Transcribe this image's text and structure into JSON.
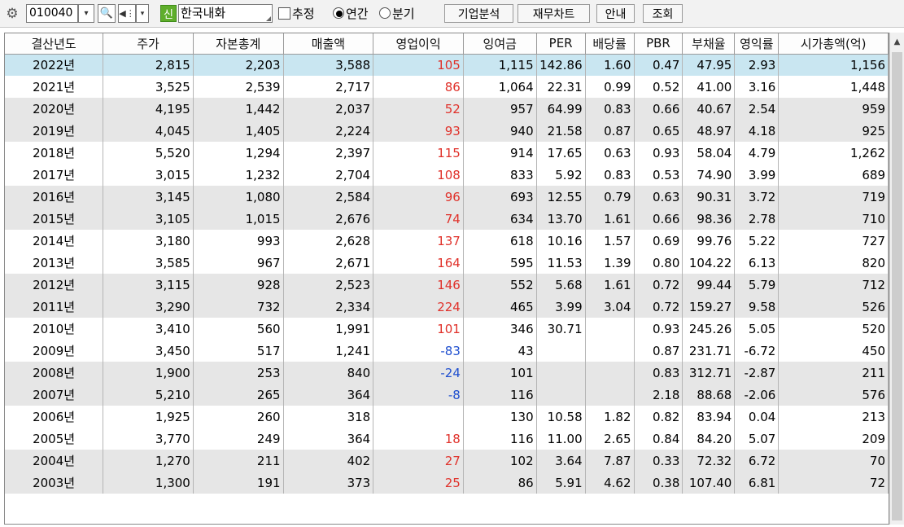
{
  "toolbar": {
    "gear_icon": "⚙",
    "stock_code": "010040",
    "dropdown_icon": "▾",
    "search_icon": "🔍",
    "tts_icon": "◀⋮",
    "new_badge": "신",
    "company_name": "한국내화",
    "estimate_label": "추정",
    "annual_label": "연간",
    "quarter_label": "분기",
    "company_analysis_label": "기업분석",
    "financial_chart_label": "재무차트",
    "guide_label": "안내",
    "query_label": "조회"
  },
  "scrollbar": {
    "up_icon": "▲"
  },
  "table": {
    "headers": [
      "결산년도",
      "주가",
      "자본총계",
      "매출액",
      "영업이익",
      "잉여금",
      "PER",
      "배당률",
      "PBR",
      "부채율",
      "영익률",
      "시가총액(억)"
    ],
    "rows": [
      [
        "2022년",
        "2,815",
        "2,203",
        "3,588",
        "105",
        "1,115",
        "142.86",
        "1.60",
        "0.47",
        "47.95",
        "2.93",
        "1,156"
      ],
      [
        "2021년",
        "3,525",
        "2,539",
        "2,717",
        "86",
        "1,064",
        "22.31",
        "0.99",
        "0.52",
        "41.00",
        "3.16",
        "1,448"
      ],
      [
        "2020년",
        "4,195",
        "1,442",
        "2,037",
        "52",
        "957",
        "64.99",
        "0.83",
        "0.66",
        "40.67",
        "2.54",
        "959"
      ],
      [
        "2019년",
        "4,045",
        "1,405",
        "2,224",
        "93",
        "940",
        "21.58",
        "0.87",
        "0.65",
        "48.97",
        "4.18",
        "925"
      ],
      [
        "2018년",
        "5,520",
        "1,294",
        "2,397",
        "115",
        "914",
        "17.65",
        "0.63",
        "0.93",
        "58.04",
        "4.79",
        "1,262"
      ],
      [
        "2017년",
        "3,015",
        "1,232",
        "2,704",
        "108",
        "833",
        "5.92",
        "0.83",
        "0.53",
        "74.90",
        "3.99",
        "689"
      ],
      [
        "2016년",
        "3,145",
        "1,080",
        "2,584",
        "96",
        "693",
        "12.55",
        "0.79",
        "0.63",
        "90.31",
        "3.72",
        "719"
      ],
      [
        "2015년",
        "3,105",
        "1,015",
        "2,676",
        "74",
        "634",
        "13.70",
        "1.61",
        "0.66",
        "98.36",
        "2.78",
        "710"
      ],
      [
        "2014년",
        "3,180",
        "993",
        "2,628",
        "137",
        "618",
        "10.16",
        "1.57",
        "0.69",
        "99.76",
        "5.22",
        "727"
      ],
      [
        "2013년",
        "3,585",
        "967",
        "2,671",
        "164",
        "595",
        "11.53",
        "1.39",
        "0.80",
        "104.22",
        "6.13",
        "820"
      ],
      [
        "2012년",
        "3,115",
        "928",
        "2,523",
        "146",
        "552",
        "5.68",
        "1.61",
        "0.72",
        "99.44",
        "5.79",
        "712"
      ],
      [
        "2011년",
        "3,290",
        "732",
        "2,334",
        "224",
        "465",
        "3.99",
        "3.04",
        "0.72",
        "159.27",
        "9.58",
        "526"
      ],
      [
        "2010년",
        "3,410",
        "560",
        "1,991",
        "101",
        "346",
        "30.71",
        "",
        "0.93",
        "245.26",
        "5.05",
        "520"
      ],
      [
        "2009년",
        "3,450",
        "517",
        "1,241",
        "-83",
        "43",
        "",
        "",
        "0.87",
        "231.71",
        "-6.72",
        "450"
      ],
      [
        "2008년",
        "1,900",
        "253",
        "840",
        "-24",
        "101",
        "",
        "",
        "0.83",
        "312.71",
        "-2.87",
        "211"
      ],
      [
        "2007년",
        "5,210",
        "265",
        "364",
        "-8",
        "116",
        "",
        "",
        "2.18",
        "88.68",
        "-2.06",
        "576"
      ],
      [
        "2006년",
        "1,925",
        "260",
        "318",
        "",
        "130",
        "10.58",
        "1.82",
        "0.82",
        "83.94",
        "0.04",
        "213"
      ],
      [
        "2005년",
        "3,770",
        "249",
        "364",
        "18",
        "116",
        "11.00",
        "2.65",
        "0.84",
        "84.20",
        "5.07",
        "209"
      ],
      [
        "2004년",
        "1,270",
        "211",
        "402",
        "27",
        "102",
        "3.64",
        "7.87",
        "0.33",
        "72.32",
        "6.72",
        "70"
      ],
      [
        "2003년",
        "1,300",
        "191",
        "373",
        "25",
        "86",
        "5.91",
        "4.62",
        "0.38",
        "107.40",
        "6.81",
        "72"
      ]
    ],
    "row_shading": [
      "sel",
      "w",
      "g",
      "g",
      "w",
      "w",
      "g",
      "g",
      "w",
      "w",
      "g",
      "g",
      "w",
      "w",
      "g",
      "g",
      "w",
      "w",
      "g",
      "g"
    ],
    "colors": {
      "positive": "#e0312a",
      "negative": "#1f4fcf",
      "selected_row": "#c9e6f1",
      "shaded_row": "#e6e6e6"
    }
  }
}
